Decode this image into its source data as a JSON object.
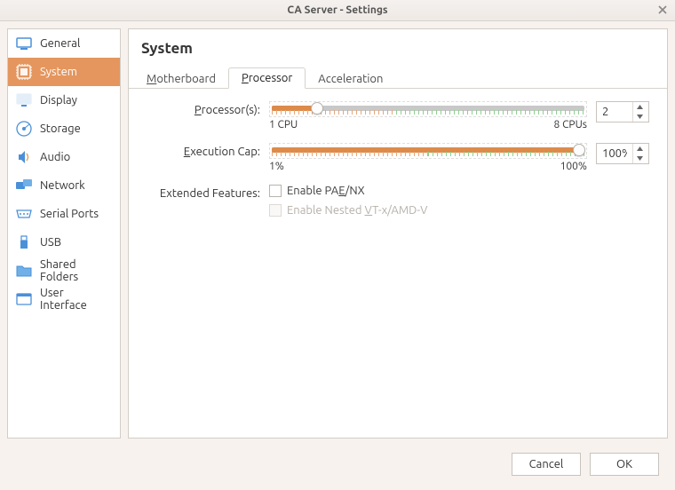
{
  "window": {
    "title": "CA Server - Settings"
  },
  "sidebar": {
    "items": [
      {
        "label": "General"
      },
      {
        "label": "System"
      },
      {
        "label": "Display"
      },
      {
        "label": "Storage"
      },
      {
        "label": "Audio"
      },
      {
        "label": "Network"
      },
      {
        "label": "Serial Ports"
      },
      {
        "label": "USB"
      },
      {
        "label": "Shared Folders"
      },
      {
        "label": "User Interface"
      }
    ],
    "selected": "System"
  },
  "page": {
    "title": "System"
  },
  "tabs": {
    "motherboard": "Motherboard",
    "processor": "Processor",
    "acceleration": "Acceleration",
    "active": "Processor"
  },
  "processor": {
    "label": "Processor(s):",
    "min_label": "1 CPU",
    "max_label": "8 CPUs",
    "value": "2",
    "slider_percent": 15
  },
  "execcap": {
    "label": "Execution Cap:",
    "min_label": "1%",
    "max_label": "100%",
    "value": "100%",
    "slider_percent": 100
  },
  "features": {
    "label": "Extended Features:",
    "pae": "Enable PAE/NX",
    "nested": "Enable Nested VT-x/AMD-V"
  },
  "footer": {
    "cancel": "Cancel",
    "ok": "OK"
  }
}
